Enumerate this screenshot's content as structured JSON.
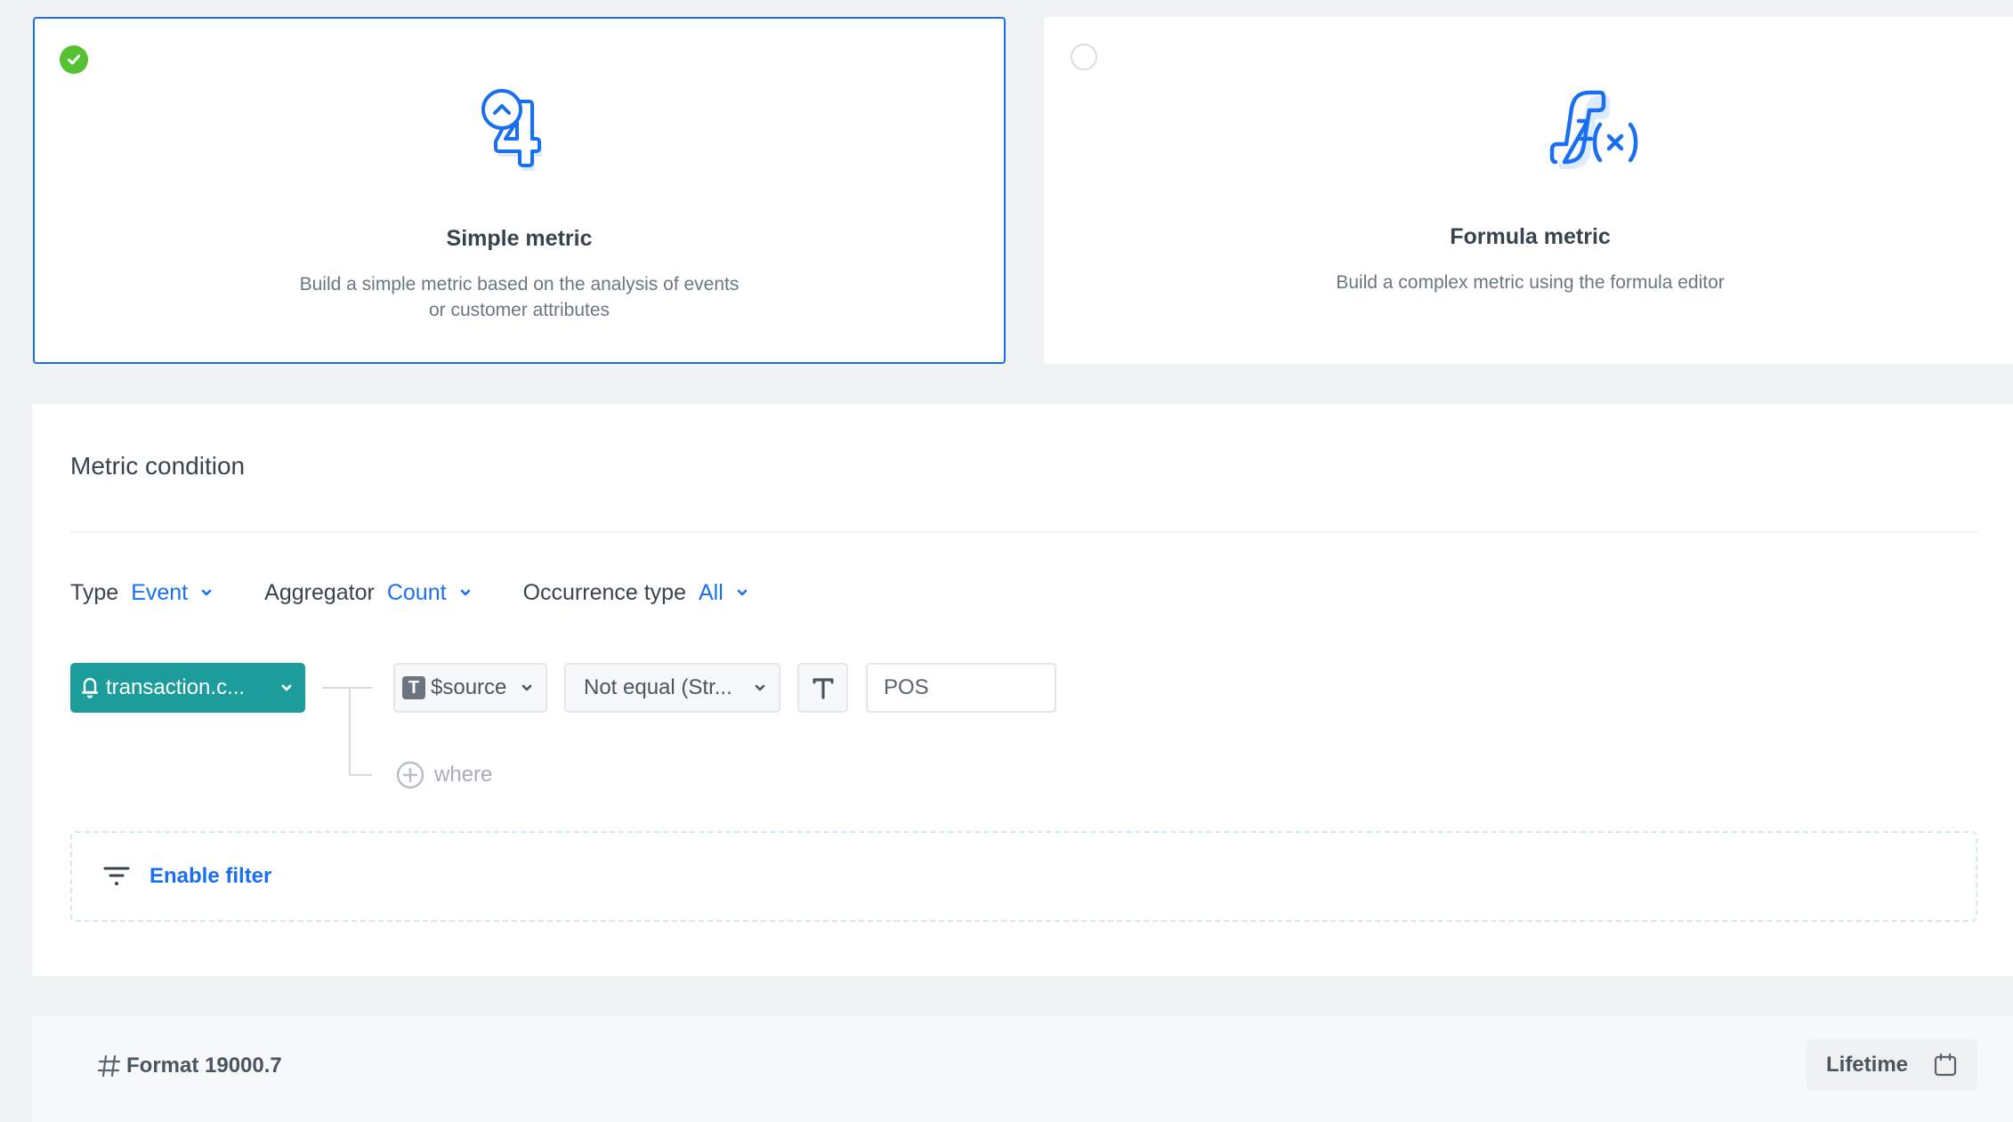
{
  "metric_types": {
    "simple": {
      "title": "Simple metric",
      "description": "Build a simple metric based on the analysis of events or customer attributes",
      "selected": true,
      "icon": "counter-4-icon"
    },
    "formula": {
      "title": "Formula metric",
      "description": "Build a complex metric using the formula editor",
      "selected": false,
      "icon": "function-fx-icon"
    }
  },
  "condition": {
    "title": "Metric condition",
    "type": {
      "label": "Type",
      "value": "Event"
    },
    "aggregator": {
      "label": "Aggregator",
      "value": "Count"
    },
    "occurrence": {
      "label": "Occurrence type",
      "value": "All"
    },
    "event": {
      "name": "transaction.c...",
      "icon": "bell-icon"
    },
    "parameter": {
      "badge": "T",
      "name": "$source"
    },
    "operator": "Not equal (Str...",
    "value_type_toggle": "T",
    "value": "POS",
    "where_label": "where",
    "enable_filter_label": "Enable filter"
  },
  "footer": {
    "format_label": "Format 19000.7",
    "period_button": "Lifetime"
  },
  "colors": {
    "accent": "#1a6ff0",
    "success": "#54c233",
    "event_chip": "#1c9c9a"
  }
}
